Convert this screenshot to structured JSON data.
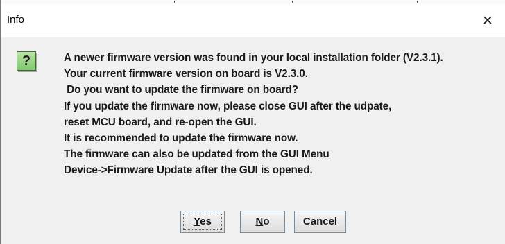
{
  "window": {
    "title": "Info",
    "close_glyph": "✕"
  },
  "icon": {
    "name": "question-icon",
    "glyph": "?",
    "color": "#7fc86c"
  },
  "message": {
    "lines": [
      "A newer firmware version was found in your local installation folder (V2.3.1).",
      "Your current firmware version on board is V2.3.0.",
      " Do you want to update the firmware on board?",
      "If you update the firmware now, please close GUI after the udpate,",
      "reset MCU board, and re-open the GUI.",
      "It is recommended to update the firmware now.",
      "The firmware can also be updated from the GUI Menu",
      "Device->Firmware Update after the GUI is opened."
    ]
  },
  "buttons": {
    "yes": {
      "mnemonic": "Y",
      "rest": "es"
    },
    "no": {
      "mnemonic": "N",
      "rest": "o"
    },
    "cancel": {
      "label": "Cancel"
    }
  }
}
